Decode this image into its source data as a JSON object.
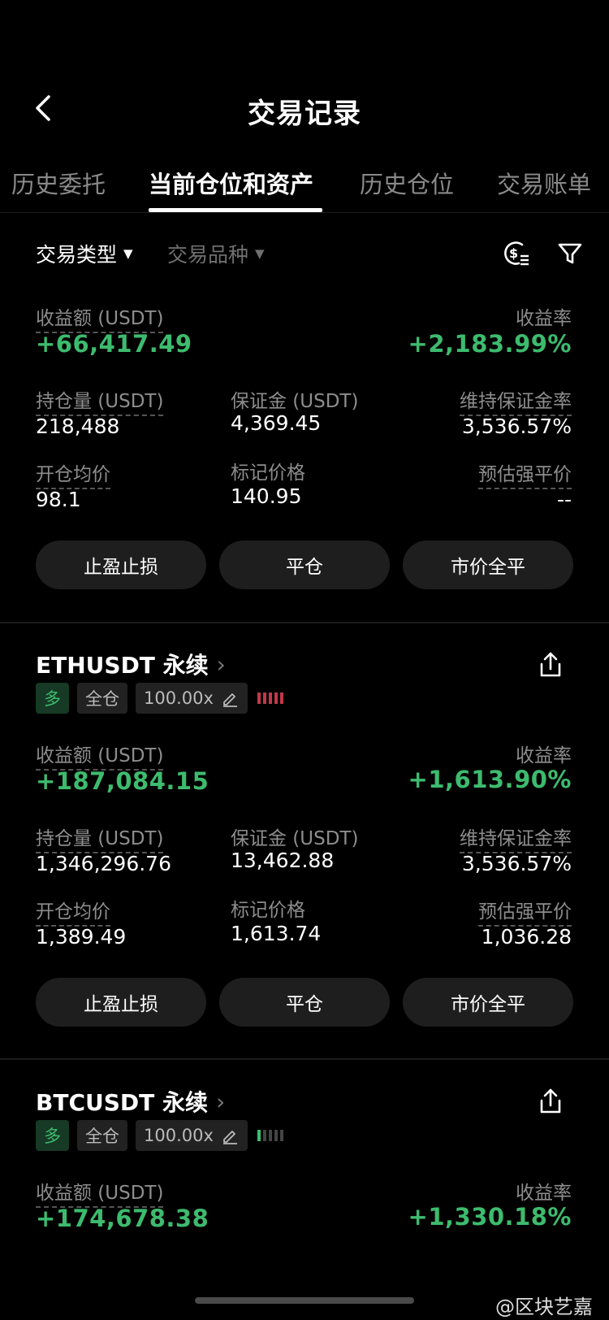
{
  "header": {
    "title": "交易记录"
  },
  "tabs": [
    {
      "label": "历史委托",
      "active": false
    },
    {
      "label": "当前仓位和资产",
      "active": true
    },
    {
      "label": "历史仓位",
      "active": false
    },
    {
      "label": "交易账单",
      "active": false
    }
  ],
  "filters": {
    "trade_type": "交易类型",
    "instrument": "交易品种"
  },
  "summary": {
    "pnl_label": "收益额 (USDT)",
    "pnl_value": "+66,417.49",
    "roi_label": "收益率",
    "roi_value": "+2,183.99%",
    "size_label": "持仓量 (USDT)",
    "size_value": "218,488",
    "margin_label": "保证金 (USDT)",
    "margin_value": "4,369.45",
    "mmr_label": "维持保证金率",
    "mmr_value": "3,536.57%",
    "entry_label": "开仓均价",
    "entry_value": "98.1",
    "mark_label": "标记价格",
    "mark_value": "140.95",
    "liq_label": "预估强平价",
    "liq_value": "--",
    "btn_tpsl": "止盈止损",
    "btn_close": "平仓",
    "btn_market_close": "市价全平"
  },
  "positions": [
    {
      "symbol": "ETHUSDT 永续",
      "side": "多",
      "mode": "全仓",
      "leverage": "100.00x",
      "pnl_label": "收益额 (USDT)",
      "pnl_value": "+187,084.15",
      "roi_label": "收益率",
      "roi_value": "+1,613.90%",
      "size_label": "持仓量 (USDT)",
      "size_value": "1,346,296.76",
      "margin_label": "保证金 (USDT)",
      "margin_value": "13,462.88",
      "mmr_label": "维持保证金率",
      "mmr_value": "3,536.57%",
      "entry_label": "开仓均价",
      "entry_value": "1,389.49",
      "mark_label": "标记价格",
      "mark_value": "1,613.74",
      "liq_label": "预估强平价",
      "liq_value": "1,036.28",
      "btn_tpsl": "止盈止损",
      "btn_close": "平仓",
      "btn_market_close": "市价全平"
    },
    {
      "symbol": "BTCUSDT 永续",
      "side": "多",
      "mode": "全仓",
      "leverage": "100.00x",
      "pnl_label": "收益额 (USDT)",
      "pnl_value": "+174,678.38",
      "roi_label": "收益率",
      "roi_value": "+1,330.18%"
    }
  ],
  "watermark": "@区块艺嘉",
  "colors": {
    "green": "#3dbb6e",
    "red": "#c0394a",
    "background": "#000000"
  }
}
